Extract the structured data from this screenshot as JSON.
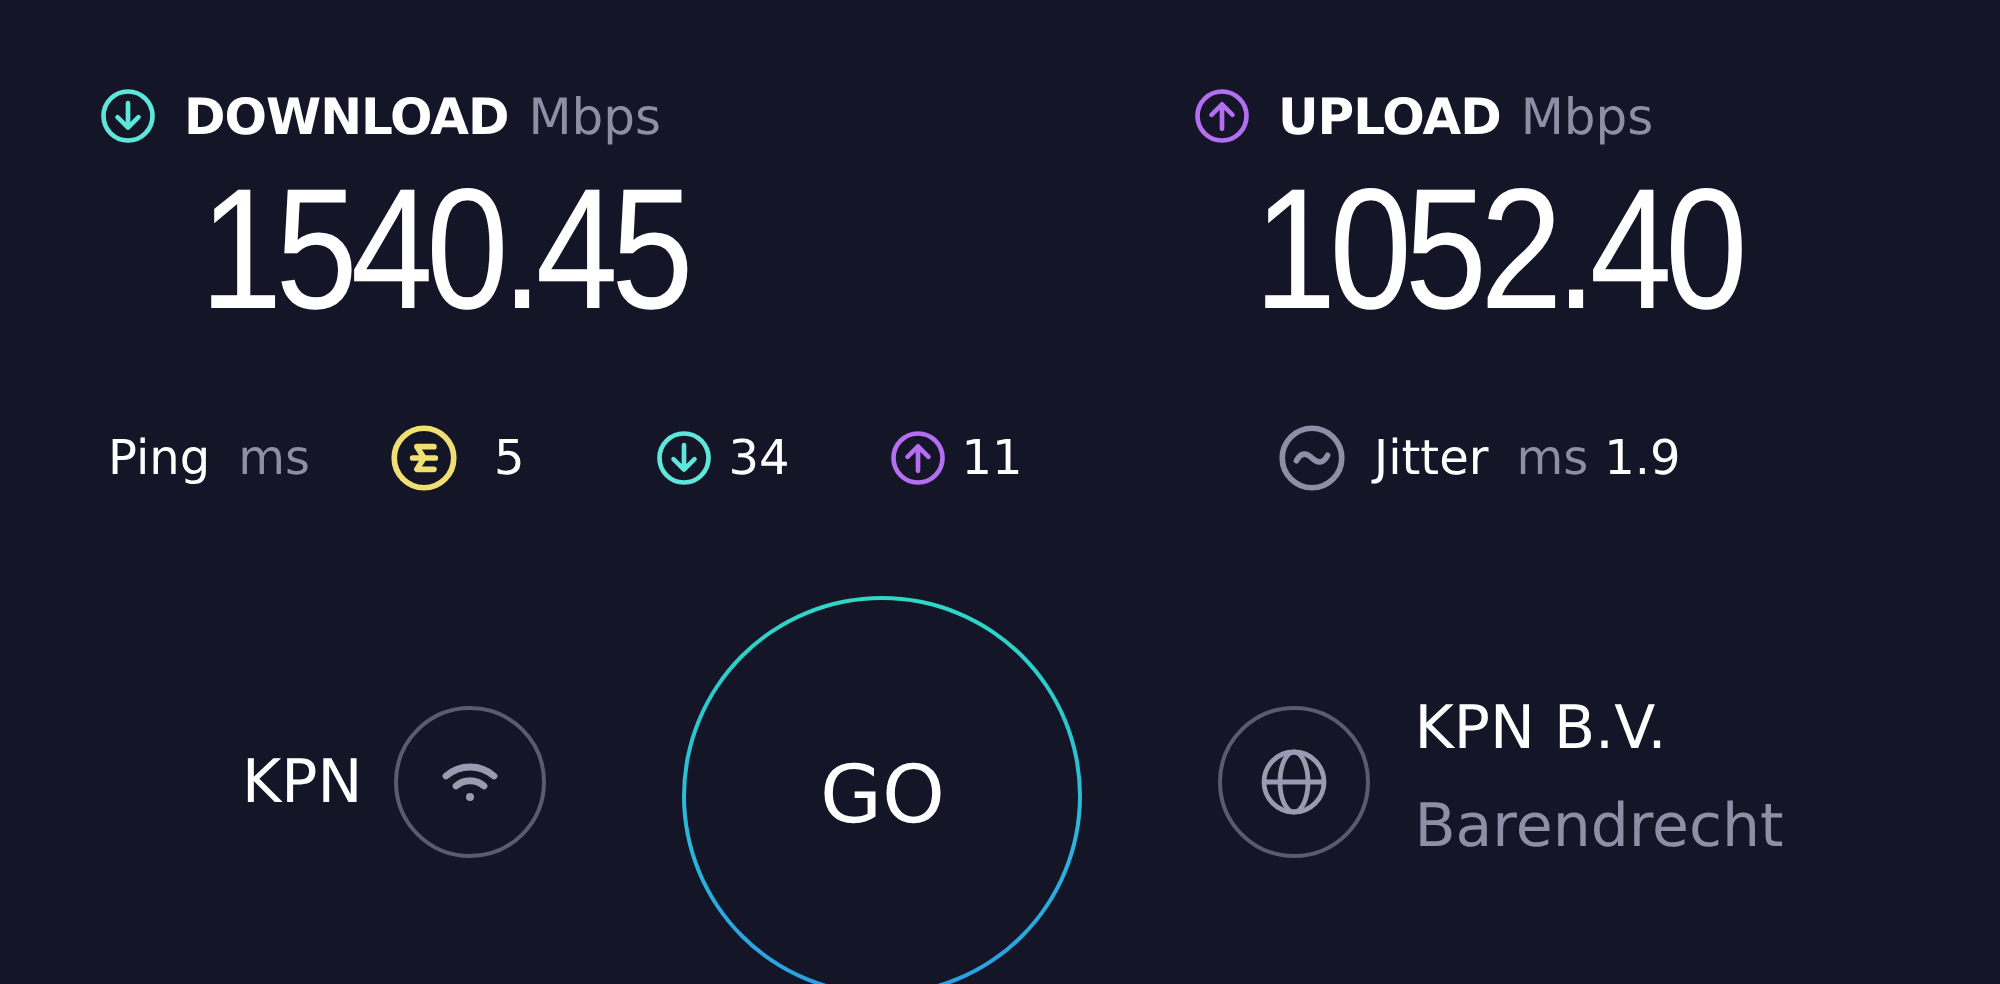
{
  "download": {
    "label": "DOWNLOAD",
    "unit": "Mbps",
    "value": "1540.45"
  },
  "upload": {
    "label": "UPLOAD",
    "unit": "Mbps",
    "value": "1052.40"
  },
  "ping": {
    "label": "Ping",
    "unit": "ms",
    "items": [
      {
        "kind": "idle",
        "value": "5"
      },
      {
        "kind": "download",
        "value": "34"
      },
      {
        "kind": "upload",
        "value": "11"
      }
    ]
  },
  "jitter": {
    "label": "Jitter",
    "unit": "ms",
    "value": "1.9"
  },
  "isp": {
    "name": "KPN"
  },
  "go": {
    "label": "GO"
  },
  "server": {
    "name": "KPN B.V.",
    "location": "Barendrecht"
  }
}
